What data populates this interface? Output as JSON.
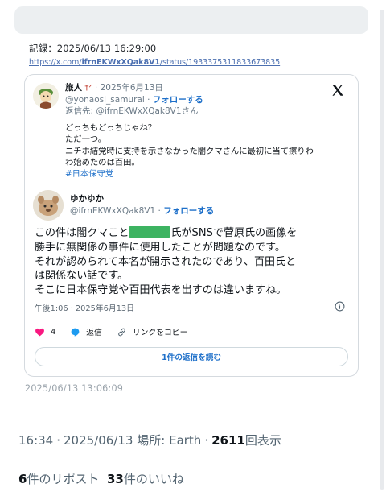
{
  "record": {
    "label": "記録：2025/06/13 16:29:00",
    "url_prefix": "https://x.com/",
    "url_user": "ifrnEKWxXQak8V1",
    "url_suffix": "/status/1933375311833673835"
  },
  "quoted": {
    "name": "旅人",
    "name_mark": "†ᐟ",
    "date": "2025年6月13日",
    "handle": "@yonaosi_samurai",
    "follow_label": "フォローする",
    "reply_to": "返信先: @ifrnEKWxXQak8V1さん",
    "lines": [
      "どっちもどっちじゃね？",
      "ただ一つ。",
      "ニチホ結党時に支持を示さなかった闇クマさんに最初に当て擦りわ",
      "わ始めたのは百田。"
    ],
    "hashtag": "#日本保守党"
  },
  "main": {
    "name": "ゆかゆか",
    "handle": "@ifrnEKWxXQak8V1",
    "follow_label": "フォローする",
    "body_before_redaction": "この件は闇クマこと",
    "body_after_redaction": "氏がSNSで菅原氏の画像を",
    "body_lines": [
      "勝手に無関係の事件に使用したことが問題なのです。",
      "それが認められて本名が開示されたのであり、百田氏と",
      "は関係ない話です。",
      "そこに日本保守党や百田代表を出すのは違いますね。"
    ],
    "timestamp": "午後1:06 · 2025年6月13日",
    "likes": "4",
    "reply_label": "返信",
    "copy_link_label": "リンクをコピー",
    "read_replies_label": "1件の返信を読む"
  },
  "original_saved_time": "2025/06/13 13:06:09",
  "meta": {
    "time": "16:34",
    "date": "2025/06/13",
    "place_label": "場所: Earth",
    "views": "2611",
    "views_label": "回表示"
  },
  "stats": {
    "reposts": "6",
    "reposts_label": "件のリポスト",
    "likes": "33",
    "likes_label": "件のいいね"
  },
  "colors": {
    "link_blue": "#1d6fc9",
    "like_red": "#f91880",
    "redaction_green": "#3db361",
    "muted_gray": "#536471"
  },
  "icons": [
    "x-logo-icon",
    "info-icon",
    "heart-icon",
    "reply-icon",
    "link-icon"
  ]
}
